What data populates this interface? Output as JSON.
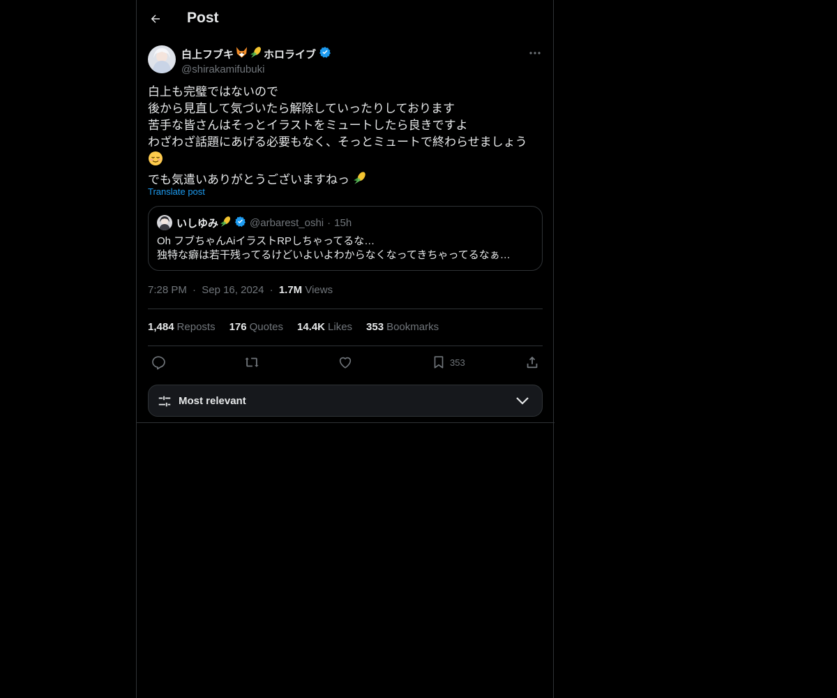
{
  "header": {
    "title": "Post"
  },
  "post": {
    "author": {
      "display_name": "白上フブキ",
      "affiliation": "ホロライブ",
      "handle": "@shirakamifubuki",
      "verified": true
    },
    "text_lines": [
      "白上も完璧ではないので",
      "後から見直して気づいたら解除していったりしております",
      "苦手な皆さんはそっとイラストをミュートしたら良きですよ",
      "わざわざ話題にあげる必要もなく、そっとミュートで終わらせましょう",
      "",
      "でも気遣いありがとうございますねっ"
    ],
    "translate_label": "Translate post",
    "quoted": {
      "display_name": "いしゆみ",
      "handle": "@arbarest_oshi",
      "separator": "·",
      "time": "15h",
      "text_lines": [
        "Oh フブちゃんAiイラストRPしちゃってるな…",
        "独特な癖は若干残ってるけどいよいよわからなくなってきちゃってるなぁ…"
      ]
    },
    "meta": {
      "time": "7:28 PM",
      "separator": "·",
      "date": "Sep 16, 2024",
      "views_count": "1.7M",
      "views_label": "Views"
    },
    "stats": {
      "reposts_count": "1,484",
      "reposts_label": "Reposts",
      "quotes_count": "176",
      "quotes_label": "Quotes",
      "likes_count": "14.4K",
      "likes_label": "Likes",
      "bookmarks_count": "353",
      "bookmarks_label": "Bookmarks"
    },
    "actions": {
      "bookmark_count": "353"
    }
  },
  "replies_sort": {
    "label": "Most relevant"
  },
  "colors": {
    "background": "#000000",
    "text": "#e7e9ea",
    "secondary": "#71767b",
    "accent": "#1d9bf0",
    "border": "#2f3336"
  },
  "icons": [
    "back-arrow-icon",
    "more-dots-icon",
    "verified-badge-icon",
    "fox-emoji-icon",
    "corn-emoji-icon",
    "relieved-face-emoji-icon",
    "reply-icon",
    "repost-icon",
    "like-icon",
    "bookmark-icon",
    "share-icon",
    "sliders-icon",
    "chevron-down-icon"
  ]
}
